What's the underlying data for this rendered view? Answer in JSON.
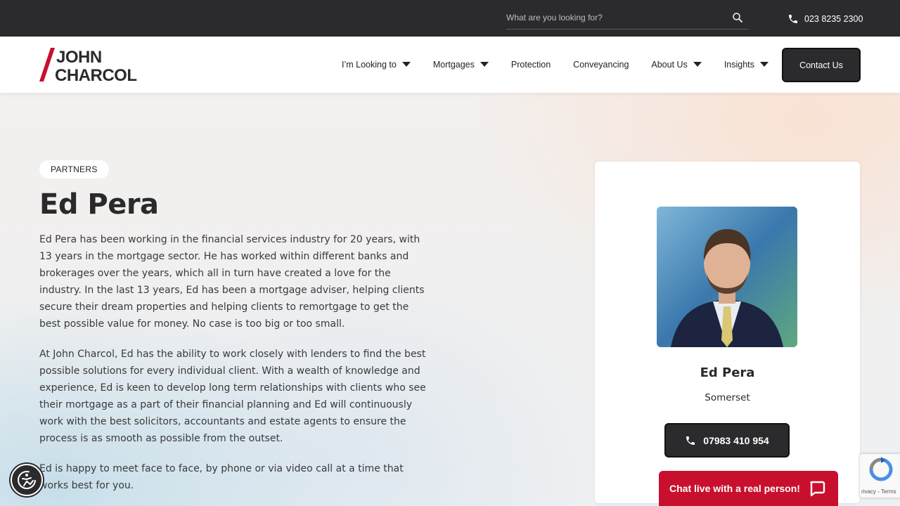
{
  "topbar": {
    "search_placeholder": "What are you looking for?",
    "phone": "023 8235 2300"
  },
  "header": {
    "logo_line1": "JOHN",
    "logo_line2": "CHARCOL",
    "nav": [
      {
        "label": "I’m Looking to",
        "dropdown": true
      },
      {
        "label": "Mortgages",
        "dropdown": true
      },
      {
        "label": "Protection",
        "dropdown": false
      },
      {
        "label": "Conveyancing",
        "dropdown": false
      },
      {
        "label": "About Us",
        "dropdown": true
      },
      {
        "label": "Insights",
        "dropdown": true
      }
    ],
    "contact_label": "Contact Us"
  },
  "profile": {
    "badge": "PARTNERS",
    "name": "Ed Pera",
    "bio": [
      "Ed Pera has been working in the financial services industry for 20 years, with 13 years in the mortgage sector. He has worked within different banks and brokerages over the years, which all in turn have created a love for the industry. In the last 13 years, Ed has been a mortgage adviser, helping clients secure their dream properties and helping clients to remortgage to get the best possible value for money. No case is too big or too small.",
      "At John Charcol, Ed has the ability to work closely with lenders to find the best possible solutions for every individual client. With a wealth of knowledge and experience, Ed is keen to develop long term relationships with clients who see their mortgage as a part of their financial planning and Ed will continuously work with the best solicitors, accountants and estate agents to ensure the process is as smooth as possible from the outset.",
      "Ed is happy to meet face to face, by phone or via video call at a time that works best for you."
    ]
  },
  "card": {
    "name": "Ed Pera",
    "location": "Somerset",
    "phone": "07983 410 954"
  },
  "chat": {
    "label": "Chat live with a real person!"
  },
  "recaptcha": {
    "terms": "rivacy - Terms"
  },
  "colors": {
    "dark": "#2b2b2d",
    "brand_red": "#c8102e"
  }
}
